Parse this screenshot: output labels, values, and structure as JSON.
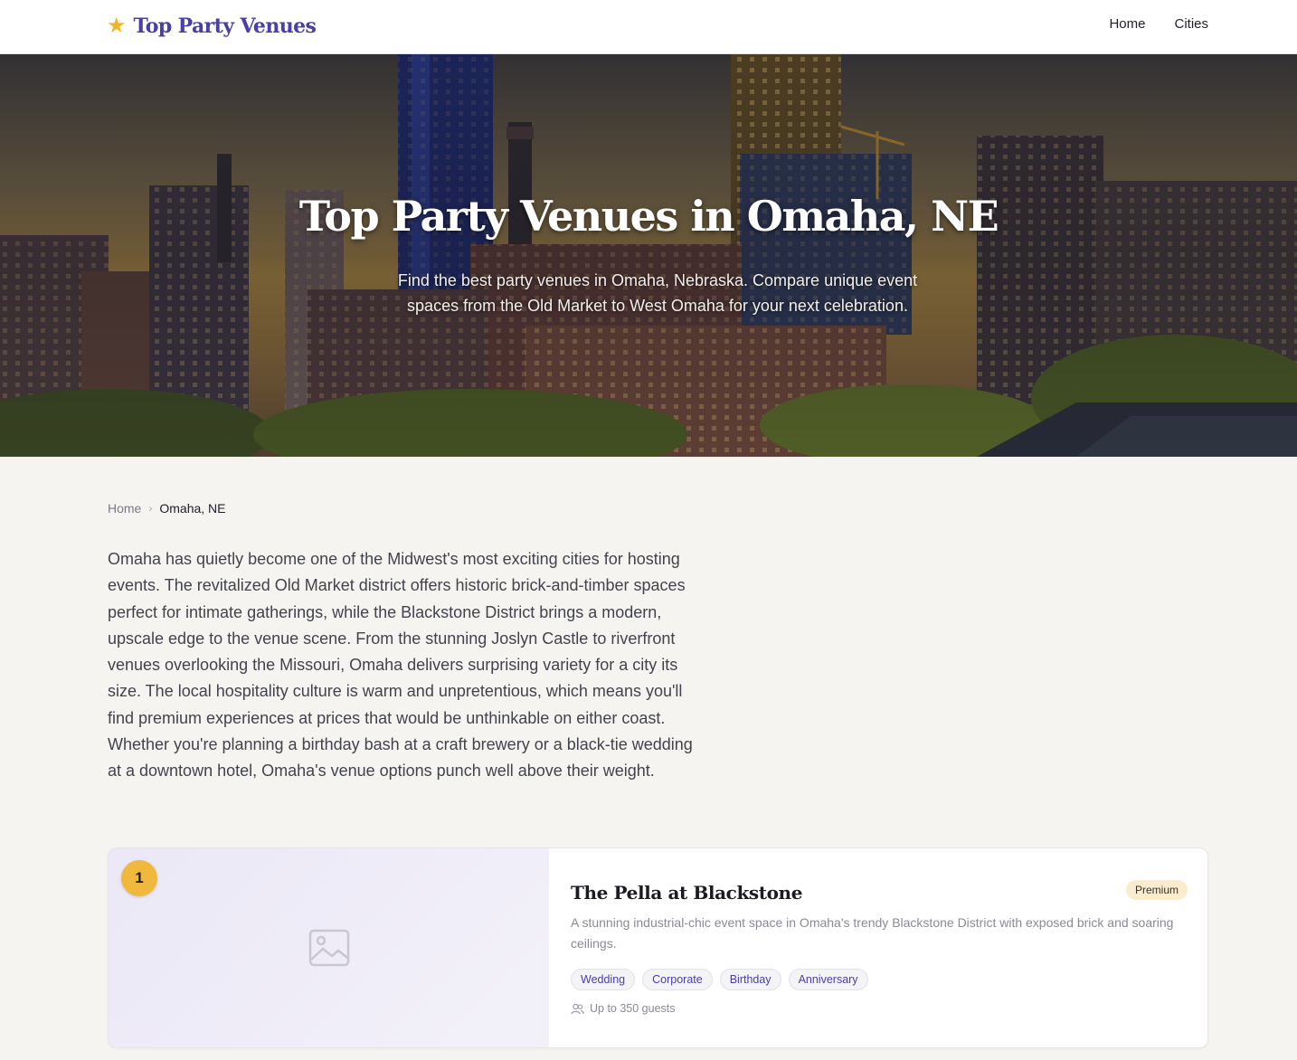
{
  "header": {
    "brand_icon": "star-icon",
    "brand_name": "Top Party Venues",
    "nav": [
      {
        "label": "Home"
      },
      {
        "label": "Cities"
      }
    ]
  },
  "hero": {
    "title": "Top Party Venues in Omaha, NE",
    "subtitle": "Find the best party venues in Omaha, Nebraska. Compare unique event spaces from the Old Market to West Omaha for your next celebration."
  },
  "breadcrumb": {
    "home": "Home",
    "separator": "›",
    "current": "Omaha, NE"
  },
  "intro": "Omaha has quietly become one of the Midwest's most exciting cities for hosting events. The revitalized Old Market district offers historic brick-and-timber spaces perfect for intimate gatherings, while the Blackstone District brings a modern, upscale edge to the venue scene. From the stunning Joslyn Castle to riverfront venues overlooking the Missouri, Omaha delivers surprising variety for a city its size. The local hospitality culture is warm and unpretentious, which means you'll find premium experiences at prices that would be unthinkable on either coast. Whether you're planning a birthday bash at a craft brewery or a black-tie wedding at a downtown hotel, Omaha's venue options punch well above their weight.",
  "venues": [
    {
      "rank": "1",
      "name": "The Pella at Blackstone",
      "badge": "Premium",
      "description": "A stunning industrial-chic event space in Omaha's trendy Blackstone District with exposed brick and soaring ceilings.",
      "tags": [
        "Wedding",
        "Corporate",
        "Birthday",
        "Anniversary"
      ],
      "guests": "Up to 350 guests",
      "image_icon": "image-placeholder-icon",
      "guests_icon": "users-icon"
    }
  ],
  "colors": {
    "brand": "#4a3fa8",
    "accent": "#f0b429",
    "background": "#f6f4f0",
    "premium_badge": "#fbeccd"
  }
}
